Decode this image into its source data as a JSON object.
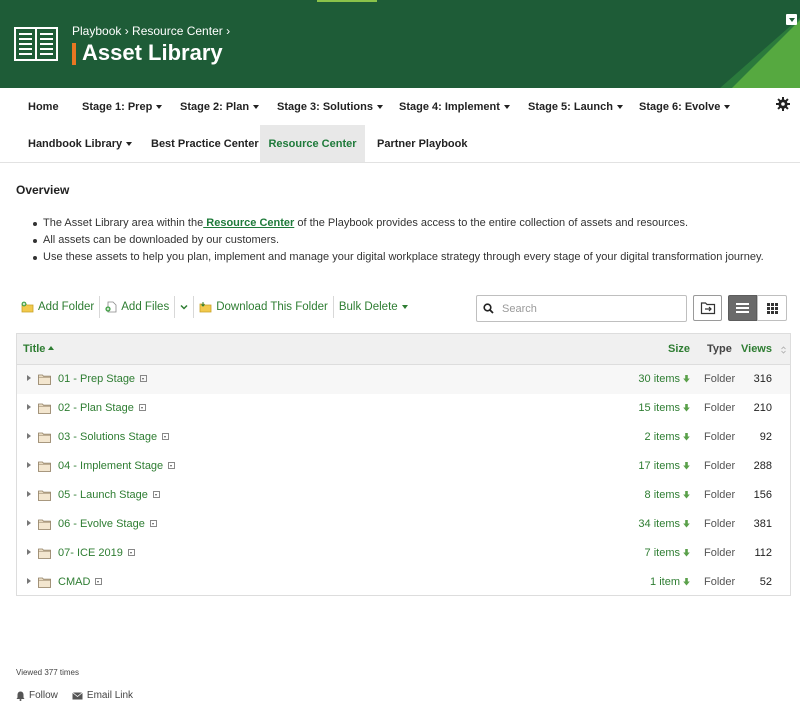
{
  "header": {
    "breadcrumb": "Playbook › Resource Center ›",
    "title": "Asset Library",
    "colors": {
      "background": "#1e5c37",
      "accent": "#e87722"
    }
  },
  "nav_primary": [
    {
      "label": "Home",
      "dropdown": false
    },
    {
      "label": "Stage 1: Prep",
      "dropdown": true
    },
    {
      "label": "Stage 2: Plan",
      "dropdown": true
    },
    {
      "label": "Stage 3: Solutions",
      "dropdown": true
    },
    {
      "label": "Stage 4: Implement",
      "dropdown": true
    },
    {
      "label": "Stage 5: Launch",
      "dropdown": true
    },
    {
      "label": "Stage 6: Evolve",
      "dropdown": true
    }
  ],
  "nav_secondary": [
    {
      "label": "Handbook Library",
      "dropdown": true
    },
    {
      "label": "Best Practice Center",
      "dropdown": false
    },
    {
      "label": "Resource Center",
      "active": true
    },
    {
      "label": "Partner Playbook",
      "dropdown": false
    }
  ],
  "overview": {
    "title": "Overview",
    "bullets": {
      "b1_before": "The Asset Library area within the",
      "b1_link": " Resource Center",
      "b1_after": " of the Playbook provides access to the entire collection of assets and resources.",
      "b2": " All assets can be downloaded by our customers.",
      "b3": "Use these assets to help you plan, implement and manage your digital workplace strategy through every stage of your digital transformation journey."
    }
  },
  "toolbar": {
    "add_folder": "Add Folder",
    "add_files": "Add Files",
    "download_folder": "Download This Folder",
    "bulk_delete": "Bulk Delete",
    "search_placeholder": "Search"
  },
  "table": {
    "columns": {
      "title": "Title",
      "size": "Size",
      "type": "Type",
      "views": "Views"
    },
    "rows": [
      {
        "name": "01 - Prep Stage",
        "size": "30 items",
        "type": "Folder",
        "views": "316"
      },
      {
        "name": "02 - Plan Stage",
        "size": "15 items",
        "type": "Folder",
        "views": "210"
      },
      {
        "name": "03 - Solutions Stage",
        "size": "2 items",
        "type": "Folder",
        "views": "92"
      },
      {
        "name": "04 - Implement Stage",
        "size": "17 items",
        "type": "Folder",
        "views": "288"
      },
      {
        "name": "05 - Launch Stage",
        "size": "8 items",
        "type": "Folder",
        "views": "156"
      },
      {
        "name": "06 - Evolve Stage",
        "size": "34 items",
        "type": "Folder",
        "views": "381"
      },
      {
        "name": "07- ICE 2019",
        "size": "7 items",
        "type": "Folder",
        "views": "112"
      },
      {
        "name": "CMAD",
        "size": "1 item",
        "type": "Folder",
        "views": "52"
      }
    ]
  },
  "footer": {
    "viewed": "Viewed 377 times",
    "follow": "Follow",
    "email_link": "Email Link"
  }
}
